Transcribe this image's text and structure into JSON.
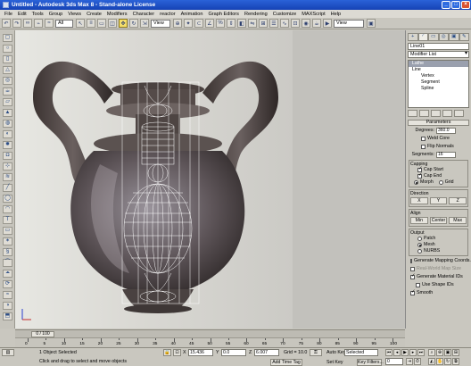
{
  "window": {
    "title": "Untitled - Autodesk 3ds Max 8 - Stand-alone License",
    "minimize": "_",
    "maximize": "□",
    "close": "×"
  },
  "menu": [
    "File",
    "Edit",
    "Tools",
    "Group",
    "Views",
    "Create",
    "Modifiers",
    "Character",
    "reactor",
    "Animation",
    "Graph Editors",
    "Rendering",
    "Customize",
    "MAXScript",
    "Help"
  ],
  "toolbar": {
    "selection_filter": "All",
    "ref_coord": "View",
    "named_sel": "View"
  },
  "viewport": {
    "label": ""
  },
  "command_panel": {
    "tabs": [
      "+",
      "◜",
      "▭",
      "◎",
      "▣",
      "✎"
    ],
    "object_name": "Line01",
    "modifier_list": "Modifier List",
    "stack": [
      {
        "label": "Lathe",
        "selected": true,
        "indent": false
      },
      {
        "label": "Line",
        "selected": false,
        "indent": false
      },
      {
        "label": "Vertex",
        "selected": false,
        "indent": true
      },
      {
        "label": "Segment",
        "selected": false,
        "indent": true
      },
      {
        "label": "Spline",
        "selected": false,
        "indent": true
      }
    ],
    "params": {
      "rollout": "Parameters",
      "degrees_label": "Degrees:",
      "degrees_value": "360.0",
      "weld_core": "Weld Core",
      "flip_normals": "Flip Normals",
      "segments_label": "Segments:",
      "segments_value": "16",
      "capping_title": "Capping",
      "cap_start": "Cap Start",
      "cap_end": "Cap End",
      "morph": "Morph",
      "grid": "Grid",
      "direction_title": "Direction",
      "dir_x": "X",
      "dir_y": "Y",
      "dir_z": "Z",
      "align_title": "Align",
      "align_min": "Min",
      "align_center": "Center",
      "align_max": "Max",
      "output_title": "Output",
      "patch": "Patch",
      "mesh": "Mesh",
      "nurbs": "NURBS",
      "gen_mapping": "Generate Mapping Coords.",
      "real_world": "Real-World Map Size",
      "gen_mat_ids": "Generate Material IDs",
      "use_shape_ids": "Use Shape IDs",
      "smooth": "Smooth"
    }
  },
  "timeline": {
    "slider_label": "0 / 100",
    "ticks": [
      "0",
      "5",
      "10",
      "15",
      "20",
      "25",
      "30",
      "35",
      "40",
      "45",
      "50",
      "55",
      "60",
      "65",
      "70",
      "75",
      "80",
      "85",
      "90",
      "95",
      "100"
    ]
  },
  "status": {
    "selection_status": "1 Object Selected",
    "prompt": "Click and drag to select and move objects",
    "x_label": "X",
    "x_value": "15.436",
    "y_label": "Y",
    "y_value": "0.0",
    "z_label": "Z",
    "z_value": "6.007",
    "grid": "Grid = 10.0",
    "add_time_tag": "Add Time Tag",
    "auto_key": "Auto Key",
    "set_key": "Set Key",
    "key_mode": "Selected",
    "key_filters": "Key Filters...",
    "frame": "0"
  }
}
